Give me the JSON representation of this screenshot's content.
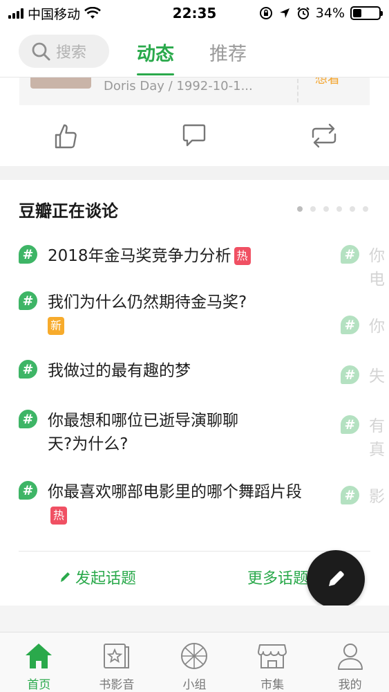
{
  "status_bar": {
    "carrier": "中国移动",
    "time": "22:35",
    "battery": "34%",
    "battery_level": 0.34
  },
  "header": {
    "search_placeholder": "搜索",
    "tabs": [
      {
        "label": "动态",
        "active": true
      },
      {
        "label": "推荐",
        "active": false
      }
    ]
  },
  "feed_card": {
    "meta": "Doris Day / 1992-10-1...",
    "status_partial": "想看"
  },
  "actions": {
    "like": "thumbs-up-icon",
    "comment": "comment-icon",
    "repost": "repost-icon"
  },
  "trending": {
    "title": "豆瓣正在谈论",
    "page_count": 6,
    "active_page": 1,
    "topics": [
      {
        "text": "2018年金马奖竞争力分析",
        "badge": "热"
      },
      {
        "text": "我们为什么仍然期待金马奖?",
        "badge": "新"
      },
      {
        "text": "我做过的最有趣的梦",
        "badge": ""
      },
      {
        "text": "你最想和哪位已逝导演聊聊天?为什么?",
        "badge": ""
      },
      {
        "text": "你最喜欢哪部电影里的哪个舞蹈片段",
        "badge": "热"
      }
    ],
    "next_page_peek": [
      "你电",
      "你",
      "失",
      "有真",
      "影"
    ],
    "start_topic": "发起话题",
    "more_topics": "更多话题"
  },
  "tabbar": {
    "items": [
      {
        "label": "首页",
        "icon": "home-icon",
        "active": true
      },
      {
        "label": "书影音",
        "icon": "book-movie-music-icon",
        "active": false
      },
      {
        "label": "小组",
        "icon": "group-icon",
        "active": false
      },
      {
        "label": "市集",
        "icon": "market-icon",
        "active": false
      },
      {
        "label": "我的",
        "icon": "profile-icon",
        "active": false
      }
    ]
  },
  "colors": {
    "accent": "#2aa94b",
    "hot": "#f05063",
    "new": "#f7ab2c",
    "fab": "#1c1c1c"
  }
}
